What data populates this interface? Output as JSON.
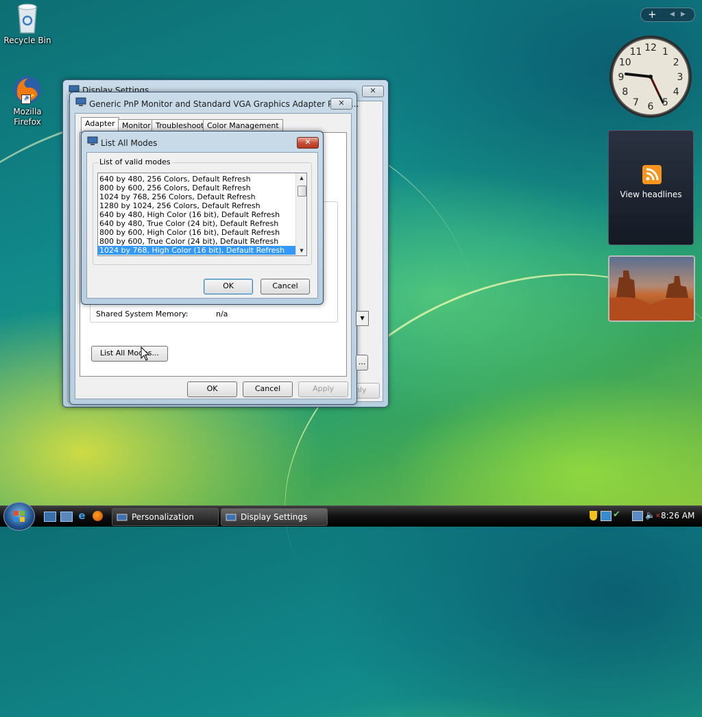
{
  "desktop": {
    "icons": [
      {
        "label": "Recycle Bin"
      },
      {
        "label": "Mozilla Firefox"
      }
    ]
  },
  "display_settings_window": {
    "title": "Display Settings",
    "apply_label": "Apply"
  },
  "adapter_props_window": {
    "title": "Generic PnP Monitor and Standard VGA Graphics Adapter Prope...",
    "tabs": [
      "Adapter",
      "Monitor",
      "Troubleshoot",
      "Color Management"
    ],
    "active_tab": "Adapter",
    "shared_memory_label": "Shared System Memory:",
    "shared_memory_value": "n/a",
    "list_all_modes_button": "List All Modes...",
    "ok_label": "OK",
    "cancel_label": "Cancel",
    "apply_label": "Apply"
  },
  "list_modes_dialog": {
    "title": "List All Modes",
    "group_label": "List of valid modes",
    "modes": [
      "640 by 480, 256 Colors, Default Refresh",
      "800 by 600, 256 Colors, Default Refresh",
      "1024 by 768, 256 Colors, Default Refresh",
      "1280 by 1024, 256 Colors, Default Refresh",
      "640 by 480, High Color (16 bit), Default Refresh",
      "640 by 480, True Color (24 bit), Default Refresh",
      "800 by 600, High Color (16 bit), Default Refresh",
      "800 by 600, True Color (24 bit), Default Refresh",
      "1024 by 768, High Color (16 bit), Default Refresh"
    ],
    "selected_index": 8,
    "ok_label": "OK",
    "cancel_label": "Cancel"
  },
  "sidebar": {
    "clock_numbers": [
      "12",
      "1",
      "2",
      "3",
      "4",
      "5",
      "6",
      "7",
      "8",
      "9",
      "10",
      "11"
    ],
    "feed_label": "View headlines"
  },
  "taskbar": {
    "tasks": [
      "Personalization",
      "Display Settings"
    ],
    "active_task": "Display Settings",
    "time": "8:26 AM"
  },
  "colors": {
    "selection": "#3399ff",
    "rss": "#f7941d"
  }
}
